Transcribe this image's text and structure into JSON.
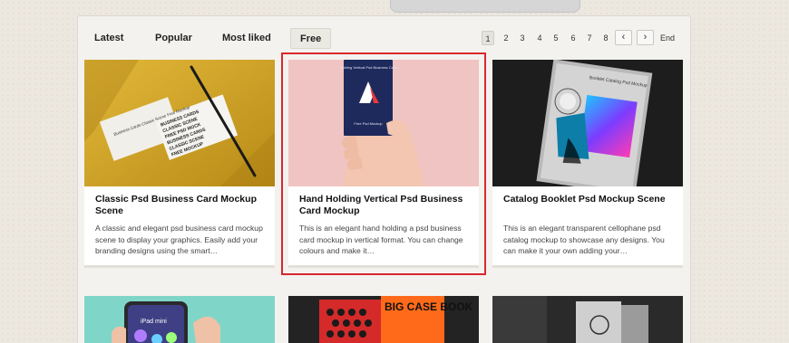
{
  "tabs": [
    {
      "label": "Latest"
    },
    {
      "label": "Popular"
    },
    {
      "label": "Most liked"
    },
    {
      "label": "Free"
    }
  ],
  "active_tab": "Free",
  "pagination": {
    "pages": [
      "1",
      "2",
      "3",
      "4",
      "5",
      "6",
      "7",
      "8"
    ],
    "current": "1",
    "prev": "‹",
    "next": "›",
    "end": "End"
  },
  "cards": [
    {
      "title": "Classic Psd Business Card Mockup Scene",
      "description": "A classic and elegant psd business card mockup scene to display your graphics. Easily add your branding designs using the smart…",
      "image_text": "Business Cards Classic Scene Free Mockup"
    },
    {
      "title": "Hand Holding Vertical Psd Business Card Mockup",
      "description": "This is an elegant hand holding a psd business card mockup in vertical format. You can change colours and make it…",
      "image_text_top": "Holding Vertical Psd Business Card",
      "image_text_bottom": "Free Psd Mockup"
    },
    {
      "title": "Catalog Booklet Psd Mockup Scene",
      "description": "This is an elegant transparent cellophane psd catalog mockup to showcase any designs. You can make it your own adding your…",
      "image_text": "Booklet Catalog Psd Mockup"
    }
  ],
  "bottom_cards": [
    {
      "image_text": "iPad mini"
    },
    {
      "image_text": "BIG CASE BOOK"
    },
    {
      "image_text": ""
    }
  ],
  "colors": {
    "page_bg": "#ece8e0",
    "panel_bg": "#f3f2ef",
    "highlight": "#d9272e",
    "card_yellow": "#d4aa2a",
    "card_pink": "#f0c4c2",
    "card_navy": "#1f2a5c",
    "card_dark": "#1d1d1d"
  }
}
